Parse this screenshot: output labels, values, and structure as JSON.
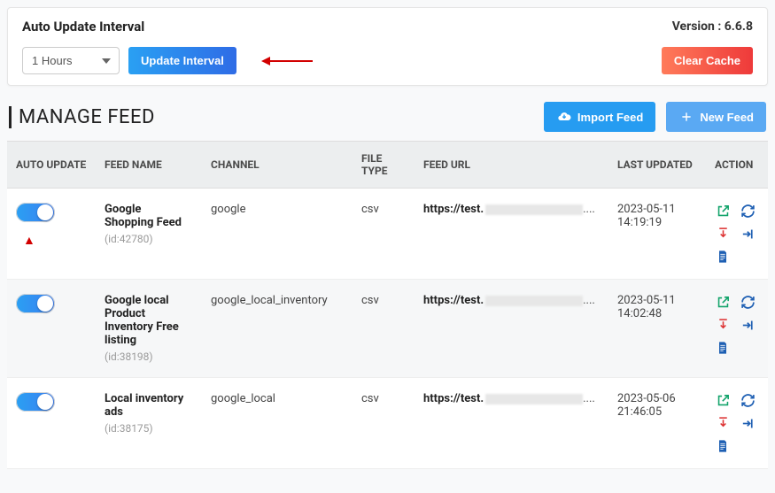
{
  "card": {
    "title": "Auto Update Interval",
    "version_label": "Version : 6.6.8",
    "interval_value": "1 Hours",
    "update_btn": "Update Interval",
    "clear_btn": "Clear Cache"
  },
  "section": {
    "title": "MANAGE FEED",
    "import_btn": "Import Feed",
    "new_btn": "New Feed"
  },
  "columns": {
    "auto_update": "AUTO UPDATE",
    "feed_name": "FEED NAME",
    "channel": "CHANNEL",
    "file_type": "FILE TYPE",
    "feed_url": "FEED URL",
    "last_updated": "LAST UPDATED",
    "action": "ACTION"
  },
  "rows": [
    {
      "name": "Google Shopping Feed",
      "id_label": "(id:42780)",
      "channel": "google",
      "file_type": "csv",
      "url_prefix": "https://test.",
      "url_suffix": "....",
      "updated_date": "2023-05-11",
      "updated_time": "14:19:19",
      "show_pointer": true
    },
    {
      "name": "Google local Product Inventory Free listing",
      "id_label": "(id:38198)",
      "channel": "google_local_inventory",
      "file_type": "csv",
      "url_prefix": "https://test.",
      "url_suffix": "....",
      "updated_date": "2023-05-11",
      "updated_time": "14:02:48",
      "show_pointer": false
    },
    {
      "name": "Local inventory ads",
      "id_label": "(id:38175)",
      "channel": "google_local",
      "file_type": "csv",
      "url_prefix": "https://test.",
      "url_suffix": "....",
      "updated_date": "2023-05-06",
      "updated_time": "21:46:05",
      "show_pointer": false
    }
  ],
  "icons": {
    "cloud": "cloud-download-icon",
    "plus": "plus-icon",
    "open": "external-link-icon",
    "refresh": "refresh-icon",
    "download": "download-icon",
    "export": "export-icon",
    "doc": "document-icon"
  }
}
